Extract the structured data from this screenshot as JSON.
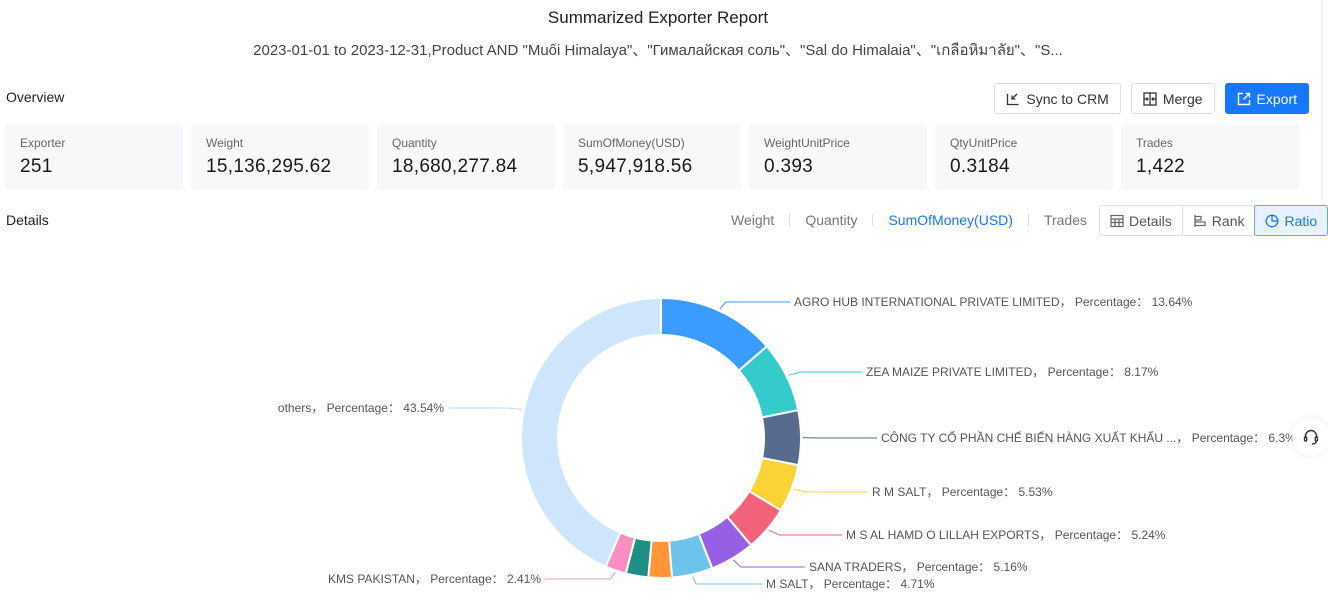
{
  "header": {
    "title": "Summarized Exporter Report",
    "subtitle": "2023-01-01 to 2023-12-31,Product AND \"Muối Himalaya\"、\"Гималайская соль\"、\"Sal do Himalaia\"、\"เกลือหิมาลัย\"、\"S..."
  },
  "overview": {
    "label": "Overview",
    "buttons": {
      "sync": "Sync to CRM",
      "merge": "Merge",
      "export": "Export"
    },
    "stats": [
      {
        "label": "Exporter",
        "value": "251"
      },
      {
        "label": "Weight",
        "value": "15,136,295.62"
      },
      {
        "label": "Quantity",
        "value": "18,680,277.84"
      },
      {
        "label": "SumOfMoney(USD)",
        "value": "5,947,918.56"
      },
      {
        "label": "WeightUnitPrice",
        "value": "0.393"
      },
      {
        "label": "QtyUnitPrice",
        "value": "0.3184"
      },
      {
        "label": "Trades",
        "value": "1,422"
      }
    ]
  },
  "details": {
    "label": "Details",
    "metric_tabs": [
      {
        "label": "Weight",
        "active": false
      },
      {
        "label": "Quantity",
        "active": false
      },
      {
        "label": "SumOfMoney(USD)",
        "active": true
      },
      {
        "label": "Trades",
        "active": false
      }
    ],
    "view_buttons": [
      {
        "label": "Details",
        "icon": "table-icon",
        "active": false
      },
      {
        "label": "Rank",
        "icon": "bar-rank-icon",
        "active": false
      },
      {
        "label": "Ratio",
        "icon": "pie-icon",
        "active": true
      }
    ]
  },
  "chart_data": {
    "type": "pie",
    "variant": "donut",
    "title": "",
    "label_format": "{name}， Percentage： {value}%",
    "start": "top",
    "direction": "clockwise",
    "slices": [
      {
        "name": "AGRO HUB INTERNATIONAL PRIVATE LIMITED",
        "value": 13.64,
        "color": "#3b9cff",
        "labeled": true
      },
      {
        "name": "ZEA MAIZE PRIVATE LIMITED",
        "value": 8.17,
        "color": "#36cbcb",
        "labeled": true
      },
      {
        "name": "CÔNG TY CỔ PHẦN CHẾ BIẾN HÀNG XUẤT KHẨU ...",
        "value": 6.3,
        "color": "#566b8e",
        "labeled": true
      },
      {
        "name": "R M SALT",
        "value": 5.53,
        "color": "#fad337",
        "labeled": true
      },
      {
        "name": "M S AL HAMD O LILLAH EXPORTS",
        "value": 5.24,
        "color": "#f2637b",
        "labeled": true
      },
      {
        "name": "SANA TRADERS",
        "value": 5.16,
        "color": "#975fe4",
        "labeled": true
      },
      {
        "name": "M SALT",
        "value": 4.71,
        "color": "#6cc3ec",
        "labeled": true
      },
      {
        "name": "",
        "value": 2.7,
        "color": "#ff9536",
        "labeled": false
      },
      {
        "name": "",
        "value": 2.6,
        "color": "#1d8f85",
        "labeled": false
      },
      {
        "name": "KMS PAKISTAN",
        "value": 2.41,
        "color": "#f78fc2",
        "labeled": true
      },
      {
        "name": "others",
        "value": 43.54,
        "color": "#cfe5fc",
        "labeled": true
      }
    ]
  }
}
